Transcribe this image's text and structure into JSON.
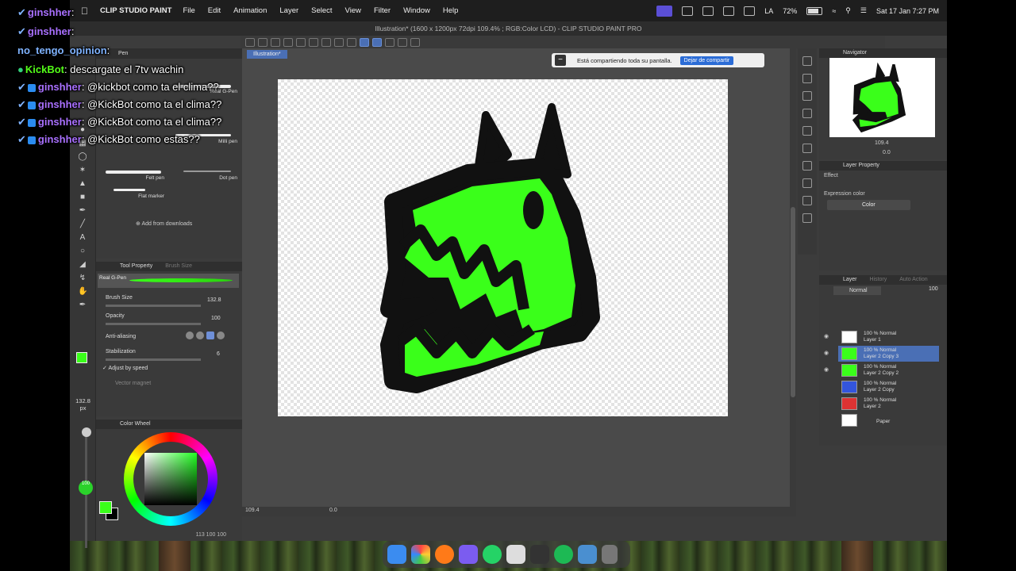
{
  "menubar": {
    "app_name": "CLIP STUDIO PAINT",
    "menus": [
      "File",
      "Edit",
      "Animation",
      "Layer",
      "Select",
      "View",
      "Filter",
      "Window",
      "Help"
    ],
    "battery": "72%",
    "keyboard": "LA",
    "datetime": "Sat 17 Jan  7:27 PM"
  },
  "window": {
    "title": "Illustration* (1600 x 1200px 72dpi 109.4% ; RGB:Color LCD) - CLIP STUDIO PAINT PRO",
    "doc_tab": "Illustration*"
  },
  "share_bar": {
    "text": "Está compartiendo toda su pantalla.",
    "button": "Dejar de compartir"
  },
  "subtool": {
    "header": "Pen",
    "brushes": [
      "Real G-Pen",
      "Milli pen",
      "Felt pen",
      "Dot pen",
      "Flat marker"
    ],
    "add_downloads": "Add from downloads"
  },
  "tool_property": {
    "title": "Tool Property",
    "tab2": "Brush Size",
    "preset": "Real G-Pen",
    "brush_size_label": "Brush Size",
    "brush_size_value": "132.8",
    "opacity_label": "Opacity",
    "opacity_value": "100",
    "antialias_label": "Anti-aliasing",
    "stabilization_label": "Stabilization",
    "stabilization_value": "6",
    "adjust_speed": "Adjust by speed",
    "vector_magnet": "Vector magnet"
  },
  "toolstrip": {
    "size_readout": "132.8",
    "size_unit": "px",
    "opacity_dot": "100"
  },
  "color_wheel": {
    "title": "Color Wheel",
    "readout": "113 100 100",
    "main_color": "#3aff1a",
    "sub_color": "#000000"
  },
  "statusbar": {
    "zoom": "109.4",
    "rotation": "0.0"
  },
  "navigator": {
    "title": "Navigator",
    "zoom": "109.4",
    "rotation": "0.0"
  },
  "layer_property": {
    "title": "Layer Property",
    "effect": "Effect",
    "expression_label": "Expression color",
    "expression_value": "Color"
  },
  "layer_panel": {
    "title": "Layer",
    "tab2": "History",
    "tab3": "Auto Action",
    "blend": "Normal",
    "opacity": "100",
    "layers": [
      {
        "pct": "100 % Normal",
        "name": "Layer 1"
      },
      {
        "pct": "100 % Normal",
        "name": "Layer 2 Copy 3"
      },
      {
        "pct": "100 % Normal",
        "name": "Layer 2 Copy 2"
      },
      {
        "pct": "100 % Normal",
        "name": "Layer 2 Copy"
      },
      {
        "pct": "100 % Normal",
        "name": "Layer 2"
      },
      {
        "pct": "",
        "name": "Paper"
      }
    ]
  },
  "chat": [
    {
      "user": "ginshher",
      "msg": ""
    },
    {
      "user": "ginshher",
      "msg": ""
    },
    {
      "user": "no_tengo_opinion",
      "msg": ""
    },
    {
      "user": "KickBot",
      "msg": "descargate el 7tv wachin"
    },
    {
      "user": "ginshher",
      "msg": "@kickbot como ta el clima??"
    },
    {
      "user": "ginshher",
      "msg": "@KickBot como ta el clima??"
    },
    {
      "user": "ginshher",
      "msg": "@KickBot como ta el clima??"
    },
    {
      "user": "ginshher",
      "msg": "@KickBot como estas??"
    }
  ],
  "colors": {
    "accent": "#4a6fb5",
    "drawing_green": "#3aff1a",
    "chat_user": "#a970ff",
    "chat_bot": "#53fc18"
  }
}
